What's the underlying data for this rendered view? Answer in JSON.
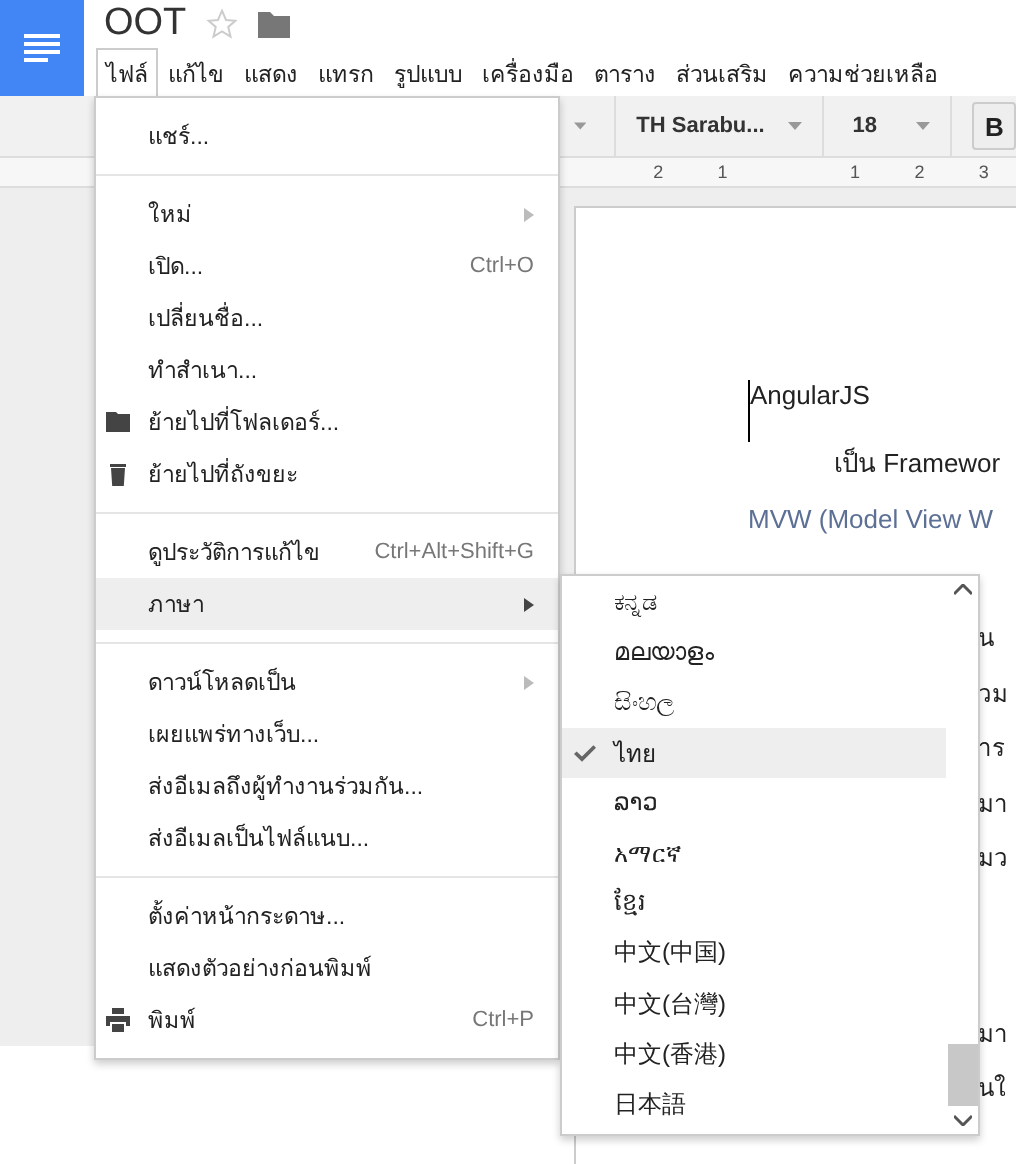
{
  "document": {
    "title": "OOT",
    "starred": false
  },
  "menubar": [
    {
      "label": "ไฟล์",
      "selected": true
    },
    {
      "label": "แก้ไข",
      "selected": false
    },
    {
      "label": "แสดง",
      "selected": false
    },
    {
      "label": "แทรก",
      "selected": false
    },
    {
      "label": "รูปแบบ",
      "selected": false
    },
    {
      "label": "เครื่องมือ",
      "selected": false
    },
    {
      "label": "ตาราง",
      "selected": false
    },
    {
      "label": "ส่วนเสริม",
      "selected": false
    },
    {
      "label": "ความช่วยเหลือ",
      "selected": false
    }
  ],
  "toolbar": {
    "font": "TH Sarabu...",
    "size": "18",
    "bold_label": "B",
    "bold": false
  },
  "ruler": [
    "2",
    "1",
    "1",
    "2",
    "3"
  ],
  "page": {
    "lines": [
      {
        "kind": "heading",
        "text": "AngularJS"
      },
      {
        "kind": "indent",
        "text": "เป็น Framewor"
      },
      {
        "kind": "plain",
        "text": "MVW (Model View W"
      }
    ],
    "fragments": [
      "น",
      "วม",
      "าร",
      "มา",
      "มว",
      "มา",
      "นใ"
    ]
  },
  "file_menu": [
    [
      {
        "label": "แชร์..."
      }
    ],
    [
      {
        "label": "ใหม่",
        "submenu": true
      },
      {
        "label": "เปิด...",
        "shortcut": "Ctrl+O"
      },
      {
        "label": "เปลี่ยนชื่อ..."
      },
      {
        "label": "ทำสำเนา..."
      },
      {
        "label": "ย้ายไปที่โฟลเดอร์...",
        "kind": "folder"
      },
      {
        "label": "ย้ายไปที่ถังขยะ",
        "kind": "trash"
      }
    ],
    [
      {
        "label": "ดูประวัติการแก้ไข",
        "shortcut": "Ctrl+Alt+Shift+G"
      },
      {
        "label": "ภาษา",
        "submenu": true,
        "open": true
      }
    ],
    [
      {
        "label": "ดาวน์โหลดเป็น",
        "submenu": true
      },
      {
        "label": "เผยแพร่ทางเว็บ..."
      },
      {
        "label": "ส่งอีเมลถึงผู้ทำงานร่วมกัน..."
      },
      {
        "label": "ส่งอีเมลเป็นไฟล์แนบ..."
      }
    ],
    [
      {
        "label": "ตั้งค่าหน้ากระดาษ..."
      },
      {
        "label": "แสดงตัวอย่างก่อนพิมพ์"
      },
      {
        "label": "พิมพ์",
        "shortcut": "Ctrl+P",
        "kind": "printer"
      }
    ]
  ],
  "language_menu": [
    {
      "label": "ಕನ್ನಡ",
      "selected": false
    },
    {
      "label": "മലയാളം",
      "selected": false
    },
    {
      "label": "සිංහල",
      "selected": false
    },
    {
      "label": "ไทย",
      "selected": true
    },
    {
      "label": "ລາວ",
      "selected": false
    },
    {
      "label": "አማርኛ",
      "selected": false
    },
    {
      "label": "ខ្មែរ",
      "selected": false
    },
    {
      "label": "中文(中国)",
      "selected": false
    },
    {
      "label": "中文(台灣)",
      "selected": false
    },
    {
      "label": "中文(香港)",
      "selected": false
    },
    {
      "label": "日本語",
      "selected": false
    }
  ]
}
